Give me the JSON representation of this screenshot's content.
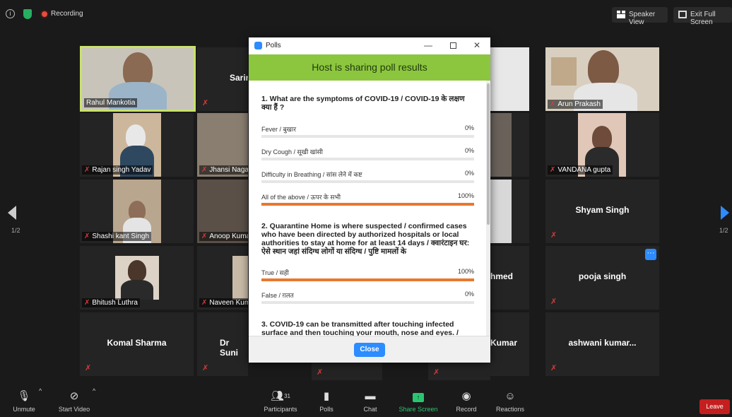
{
  "topbar": {
    "recording_label": "Recording",
    "speaker_view_label": "Speaker View",
    "exit_full_label": "Exit Full Screen"
  },
  "participants": {
    "rahul": "Rahul Mankotia",
    "sarin": "Sarin",
    "arun": "Arun Prakash",
    "rajan": "Rajan singh Yadav",
    "jhansi": "Jhansi Nagar",
    "vandana": "VANDANA gupta",
    "shashi": "Shashi kant Singh",
    "anoop": "Anoop Kuma",
    "shyam": "Shyam Singh",
    "bhitush": "Bhitush Luthra",
    "naveen": "Naveen Kum",
    "ahmed": "hmed",
    "pooja": "pooja singh",
    "komal": "Komal Sharma",
    "suni": "Dr Suni",
    "kumar": "Kumar",
    "ashwani": "ashwani  kumar..."
  },
  "paging": {
    "left": "1/2",
    "right": "1/2"
  },
  "polls": {
    "window_title": "Polls",
    "banner": "Host is sharing poll results",
    "questions": [
      {
        "text": "1. What are the symptoms of COVID-19 / COVID-19 के लक्षण क्या हैं ?",
        "options": [
          {
            "label": "Fever / बुखार",
            "percent": "0%",
            "value": 0
          },
          {
            "label": "Dry Cough / सूखी खांसी",
            "percent": "0%",
            "value": 0
          },
          {
            "label": "Difficulty in Breathing / सांस लेने में कष्ट",
            "percent": "0%",
            "value": 0
          },
          {
            "label": "All of the above / ऊपर के सभी",
            "percent": "100%",
            "value": 100
          }
        ]
      },
      {
        "text": "2. Quarantine Home is where suspected / confirmed cases who have been directed by authorized hospitals or local authorities to stay at home for at least 14 days       /         क्वारंटाइन घर: ऐसे स्थान जहां संदिग्ध लोगों या संदिग्ध / पुष्टि मामलों के",
        "options": [
          {
            "label": "True / सही",
            "percent": "100%",
            "value": 100
          },
          {
            "label": "False / ग़लत",
            "percent": "0%",
            "value": 0
          }
        ]
      },
      {
        "text": "3. COVID-19 can be transmitted after touching infected surface and then touching your mouth, nose and eyes.      /"
      }
    ],
    "close_label": "Close"
  },
  "toolbar": {
    "unmute": "Unmute",
    "start_video": "Start Video",
    "participants": "Participants",
    "participants_count": "31",
    "polls": "Polls",
    "chat": "Chat",
    "share_screen": "Share Screen",
    "record": "Record",
    "reactions": "Reactions",
    "leave": "Leave"
  },
  "colors": {
    "accent": "#2d8cff",
    "poll_banner": "#8cc63f",
    "bar_fill": "#e8772e",
    "active_speaker": "#c8e26a",
    "share_green": "#28c76f",
    "leave_red": "#c41f1f"
  }
}
